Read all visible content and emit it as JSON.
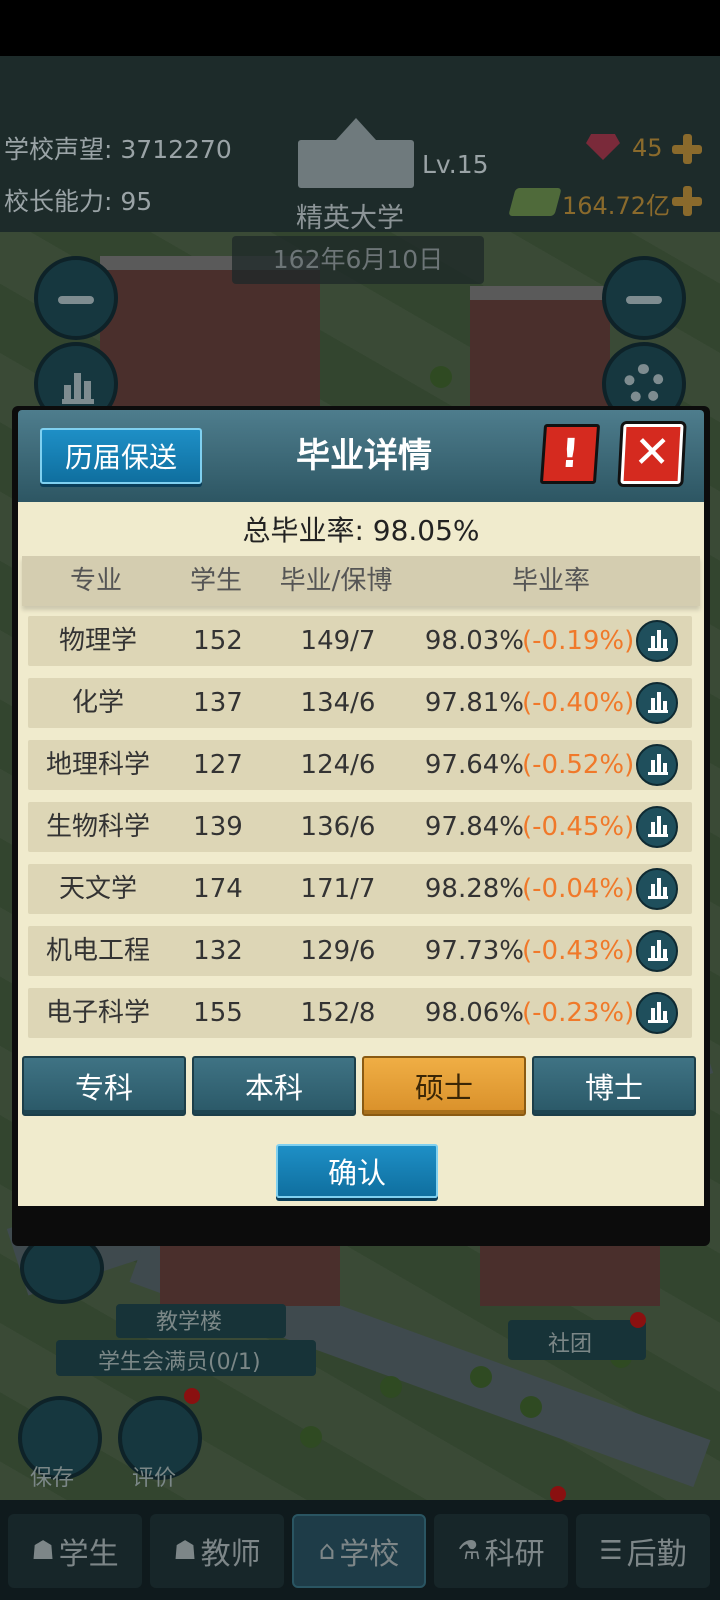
{
  "hud": {
    "reputation_label": "学校声望:",
    "reputation_value": "3712270",
    "ability_label": "校长能力:",
    "ability_value": "95",
    "level": "Lv.15",
    "school_name": "精英大学",
    "gems": "45",
    "money": "164.72亿",
    "date": "162年6月10日"
  },
  "dialog": {
    "history_button": "历届保送",
    "title": "毕业详情",
    "alert_label": "!",
    "close_label": "✕",
    "total_rate": "总毕业率:  98.05%",
    "columns": [
      "专业",
      "学生",
      "毕业/保博",
      "毕业率"
    ],
    "rows": [
      {
        "name": "物理学",
        "students": "152",
        "graduated": "149/7",
        "rate": "98.03%",
        "change": "(-0.19%)"
      },
      {
        "name": "化学",
        "students": "137",
        "graduated": "134/6",
        "rate": "97.81%",
        "change": "(-0.40%)"
      },
      {
        "name": "地理科学",
        "students": "127",
        "graduated": "124/6",
        "rate": "97.64%",
        "change": "(-0.52%)"
      },
      {
        "name": "生物科学",
        "students": "139",
        "graduated": "136/6",
        "rate": "97.84%",
        "change": "(-0.45%)"
      },
      {
        "name": "天文学",
        "students": "174",
        "graduated": "171/7",
        "rate": "98.28%",
        "change": "(-0.04%)"
      },
      {
        "name": "机电工程",
        "students": "132",
        "graduated": "129/6",
        "rate": "97.73%",
        "change": "(-0.43%)"
      },
      {
        "name": "电子科学",
        "students": "155",
        "graduated": "152/8",
        "rate": "98.06%",
        "change": "(-0.23%)"
      }
    ],
    "tabs": [
      {
        "label": "专科",
        "active": false
      },
      {
        "label": "本科",
        "active": false
      },
      {
        "label": "硕士",
        "active": true
      },
      {
        "label": "博士",
        "active": false
      }
    ],
    "confirm_button": "确认",
    "accent_color": "#f0792a"
  },
  "background": {
    "building_label": "教学楼",
    "council_label": "学生会满员(0/1)",
    "club_label": "社团",
    "save_label": "保存",
    "review_label": "评价"
  },
  "nav": {
    "items": [
      {
        "label": "学生",
        "icon": "student-icon",
        "active": false
      },
      {
        "label": "教师",
        "icon": "teacher-icon",
        "active": false
      },
      {
        "label": "学校",
        "icon": "school-icon",
        "active": true
      },
      {
        "label": "科研",
        "icon": "flask-icon",
        "active": false
      },
      {
        "label": "后勤",
        "icon": "clipboard-icon",
        "active": false
      }
    ]
  }
}
